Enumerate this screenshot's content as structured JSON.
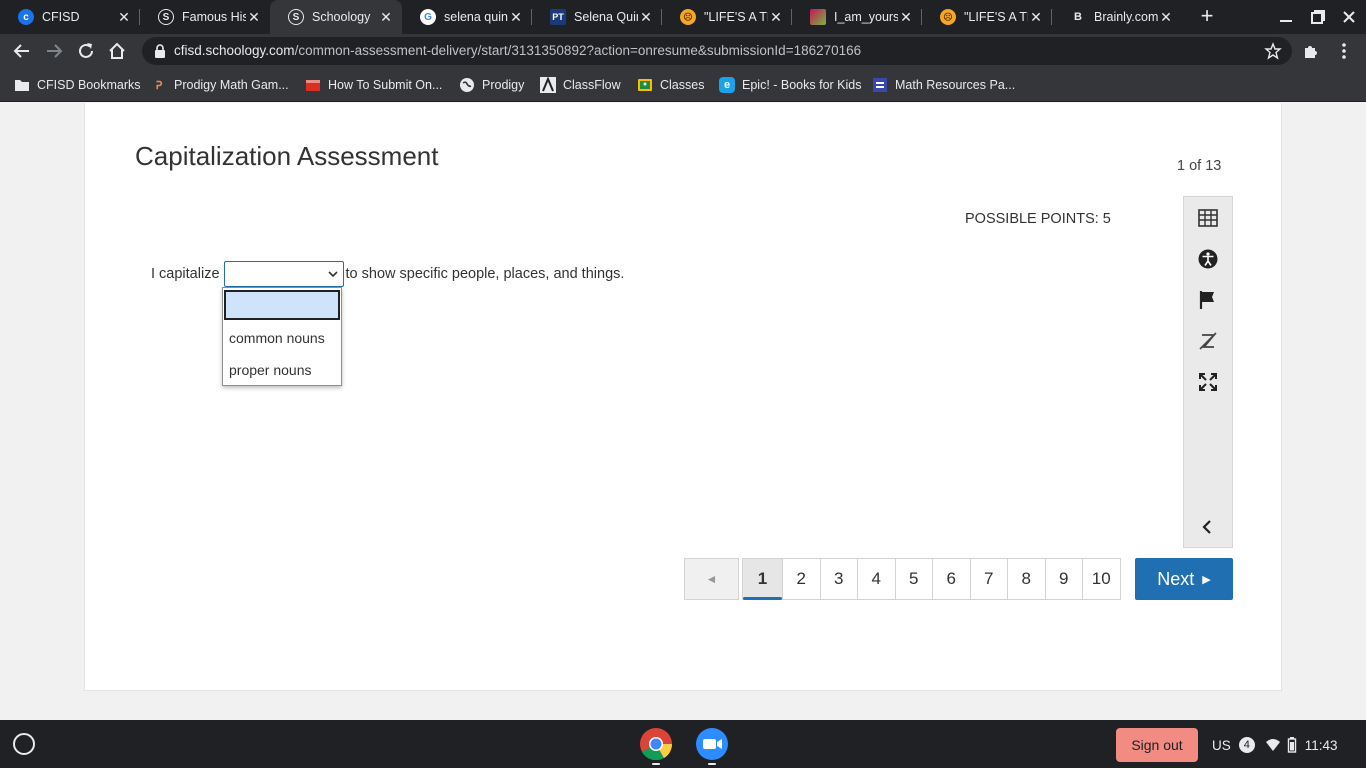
{
  "browser": {
    "tabs": [
      {
        "title": "CFISD",
        "icon": "cfisd-favicon"
      },
      {
        "title": "Famous His",
        "icon": "schoology-favicon"
      },
      {
        "title": "Schoology",
        "icon": "schoology-favicon",
        "active": true
      },
      {
        "title": "selena quint",
        "icon": "google-favicon"
      },
      {
        "title": "Selena Quint",
        "icon": "pt-favicon"
      },
      {
        "title": "\"LIFE'S A TR",
        "icon": "emoji-favicon"
      },
      {
        "title": "I_am_yours_",
        "icon": "image-favicon"
      },
      {
        "title": "\"LIFE'S A TR",
        "icon": "emoji-favicon"
      },
      {
        "title": "Brainly.com",
        "icon": "brainly-favicon"
      }
    ],
    "url_host": "cfisd.schoology.com",
    "url_path": "/common-assessment-delivery/start/3131350892?action=onresume&submissionId=186270166",
    "bookmarks": [
      {
        "label": "CFISD Bookmarks",
        "icon": "folder-icon"
      },
      {
        "label": "Prodigy Math Gam...",
        "icon": "prodigy-icon"
      },
      {
        "label": "How To Submit On...",
        "icon": "film-icon"
      },
      {
        "label": "Prodigy",
        "icon": "globe-icon"
      },
      {
        "label": "ClassFlow",
        "icon": "classflow-icon"
      },
      {
        "label": "Classes",
        "icon": "classroom-icon"
      },
      {
        "label": "Epic! - Books for Kids",
        "icon": "epic-icon"
      },
      {
        "label": "Math Resources Pa...",
        "icon": "forms-icon"
      }
    ]
  },
  "assessment": {
    "title": "Capitalization Assessment",
    "counter": "1 of 13",
    "possible_points": "POSSIBLE POINTS: 5",
    "question_before": "I capitalize",
    "question_after": "to show specific people, places, and things.",
    "dropdown_options": [
      "",
      "common nouns",
      "proper nouns"
    ],
    "tools": [
      "calculator-icon",
      "accessibility-icon",
      "flag-icon",
      "eliminate-answer-icon",
      "fullscreen-icon",
      "collapse-icon"
    ],
    "pages": [
      "1",
      "2",
      "3",
      "4",
      "5",
      "6",
      "7",
      "8",
      "9",
      "10"
    ],
    "current_page": "1",
    "prev_glyph": "◄",
    "next_label": "Next"
  },
  "shelf": {
    "signout_label": "Sign out",
    "locale": "US",
    "notification_count": "4",
    "time": "11:43"
  },
  "colors": {
    "accent": "#1f6fb2",
    "signout": "#f28b82",
    "chrome_dark": "#202124",
    "chrome_toolbar": "#35363a"
  }
}
